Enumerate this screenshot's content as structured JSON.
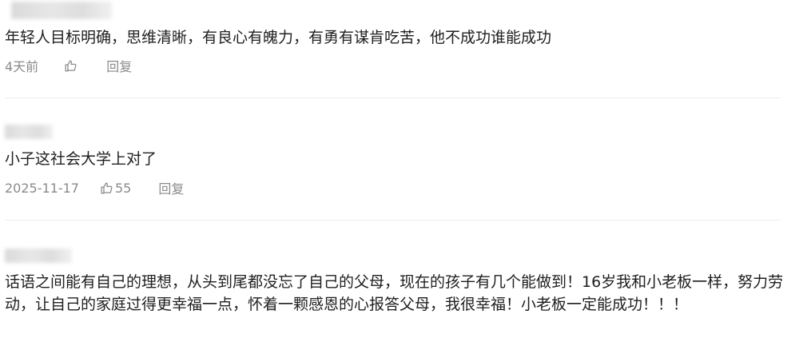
{
  "comments": [
    {
      "text": "年轻人目标明确，思维清晰，有良心有魄力，有勇有谋肯吃苦，他不成功谁能成功",
      "time": "4天前",
      "like_count": "",
      "reply_label": "回复"
    },
    {
      "text": "小子这社会大学上对了",
      "time": "2025-11-17",
      "like_count": "55",
      "reply_label": "回复"
    },
    {
      "text": "话语之间能有自己的理想，从头到尾都没忘了自己的父母，现在的孩子有几个能做到！16岁我和小老板一样，努力劳动，让自己的家庭过得更幸福一点，怀着一颗感恩的心报答父母，我很幸福！小老板一定能成功！！！",
      "time": "",
      "like_count": "",
      "reply_label": ""
    }
  ],
  "icons": {
    "like": "thumbs-up-icon"
  },
  "colors": {
    "text": "#1f1f1f",
    "meta": "#8a8a8a",
    "divider": "#ececec"
  }
}
